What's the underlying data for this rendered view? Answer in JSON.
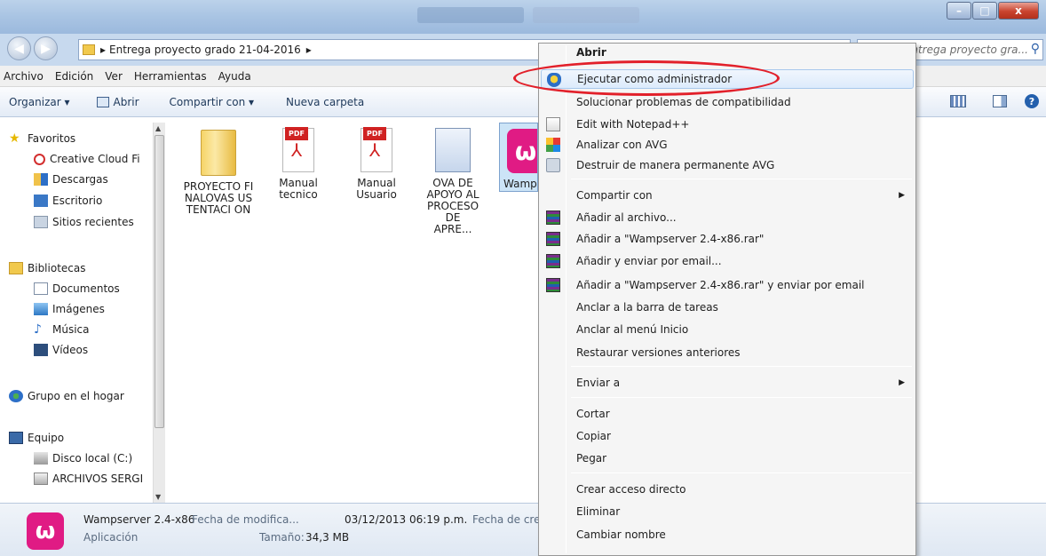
{
  "window": {
    "minimize": "–",
    "maximize": "□",
    "close": "x"
  },
  "address": {
    "path_root_arrow": "▸",
    "path": "Entrega proyecto grado 21-04-2016",
    "path_arrow": "▸",
    "search_placeholder": "Buscar Entrega proyecto gra..."
  },
  "menubar": [
    "Archivo",
    "Edición",
    "Ver",
    "Herramientas",
    "Ayuda"
  ],
  "toolbar": {
    "organize": "Organizar ▾",
    "open": "Abrir",
    "share": "Compartir con ▾",
    "new_folder": "Nueva carpeta",
    "help": "?"
  },
  "nav": {
    "favorites": "Favoritos",
    "creative_cloud": "Creative Cloud Fi",
    "downloads": "Descargas",
    "desktop": "Escritorio",
    "recent": "Sitios recientes",
    "libraries": "Bibliotecas",
    "documents": "Documentos",
    "images": "Imágenes",
    "music": "Música",
    "videos": "Vídeos",
    "homegroup": "Grupo en el hogar",
    "computer": "Equipo",
    "local_disk": "Disco local (C:)",
    "archivos": "ARCHIVOS SERGI"
  },
  "files": [
    {
      "name": "PROYECTO FINALOVAS USTENTACI ON"
    },
    {
      "name": "Manual tecnico"
    },
    {
      "name": "Manual Usuario"
    },
    {
      "name": "OVA DE APOYO AL PROCESO DE APRE..."
    },
    {
      "name": "Wamp r 2.4-"
    }
  ],
  "pdf_label": "PDF",
  "status": {
    "name": "Wampserver 2.4-x86",
    "type": "Aplicación",
    "modified_label": "Fecha de modifica...",
    "modified_value": "03/12/2013 06:19 p.m.",
    "size_label": "Tamaño:",
    "size_value": "34,3 MB",
    "created_label": "Fecha de crea"
  },
  "context_menu": {
    "open": "Abrir",
    "run_as_admin": "Ejecutar como administrador",
    "troubleshoot": "Solucionar problemas de compatibilidad",
    "notepad": "Edit with Notepad++",
    "avg_scan": "Analizar con AVG",
    "avg_shred": "Destruir de manera permanente AVG",
    "share_with": "Compartir con",
    "add_archive": "Añadir al archivo...",
    "add_rar": "Añadir a \"Wampserver 2.4-x86.rar\"",
    "add_email": "Añadir y enviar por email...",
    "add_rar_email": "Añadir a \"Wampserver 2.4-x86.rar\" y enviar por email",
    "pin_taskbar": "Anclar a la barra de tareas",
    "pin_start": "Anclar al menú Inicio",
    "restore": "Restaurar versiones anteriores",
    "send_to": "Enviar a",
    "cut": "Cortar",
    "copy": "Copiar",
    "paste": "Pegar",
    "shortcut": "Crear acceso directo",
    "delete": "Eliminar",
    "rename": "Cambiar nombre",
    "submenu_arrow": "▶"
  },
  "colors": {
    "highlight_circle": "#e2202a",
    "wamp_brand": "#e01b84"
  }
}
